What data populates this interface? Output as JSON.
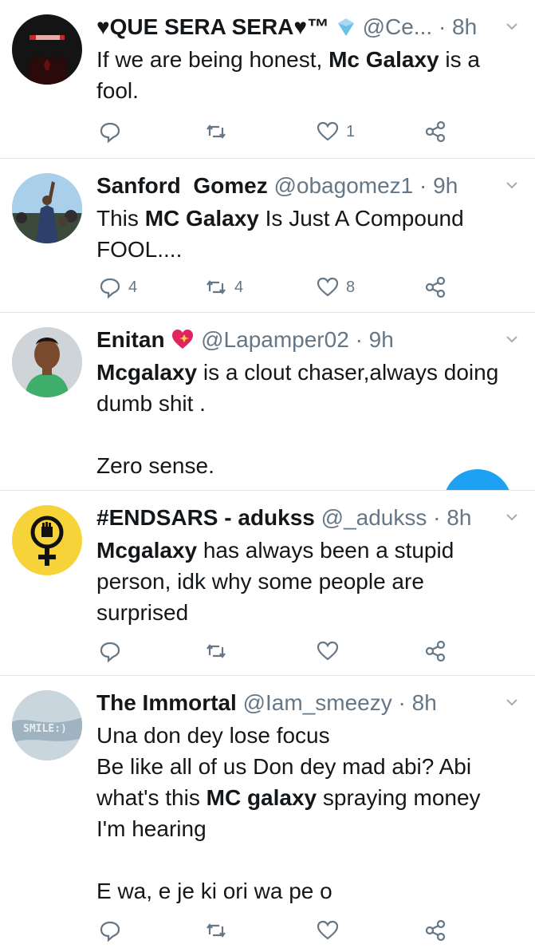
{
  "tweets": [
    {
      "name": "♥QUE SERA SERA♥™",
      "handle": "@Ce...",
      "sep": "·",
      "time": "8h",
      "body": [
        [
          {
            "t": "If we are being honest, "
          },
          {
            "t": "Mc Galaxy",
            "b": true
          },
          {
            "t": " is a fool."
          }
        ]
      ],
      "counts": {
        "reply": "",
        "retweet": "",
        "like": "1"
      }
    },
    {
      "name": "Sanford  Gomez",
      "handle": "@obagomez1",
      "sep": "·",
      "time": "9h",
      "body": [
        [
          {
            "t": "This "
          },
          {
            "t": "MC Galaxy",
            "b": true
          },
          {
            "t": " Is Just A Compound FOOL...."
          }
        ]
      ],
      "counts": {
        "reply": "4",
        "retweet": "4",
        "like": "8"
      }
    },
    {
      "name": "Enitan",
      "handle": "@Lapamper02",
      "sep": "·",
      "time": "9h",
      "body": [
        [
          {
            "t": "Mcgalaxy",
            "b": true
          },
          {
            "t": " is a clout chaser,always doing dumb shit ."
          }
        ],
        [
          {
            "t": "Zero sense."
          }
        ]
      ],
      "counts": {
        "reply": "",
        "retweet": "",
        "like": ""
      }
    },
    {
      "name": "#ENDSARS - adukss",
      "handle": "@_adukss",
      "sep": "·",
      "time": "8h",
      "body": [
        [
          {
            "t": "Mcgalaxy",
            "b": true
          },
          {
            "t": " has always been a stupid person, idk why some people are surprised"
          }
        ]
      ],
      "counts": {
        "reply": "",
        "retweet": "",
        "like": ""
      }
    },
    {
      "name": "The Immortal",
      "handle": "@Iam_smeezy",
      "sep": "·",
      "time": "8h",
      "body": [
        [
          {
            "t": "Una don dey lose focus"
          }
        ],
        [
          {
            "t": "Be like all of us Don dey mad abi? Abi what's this "
          },
          {
            "t": "MC galaxy",
            "b": true
          },
          {
            "t": " spraying money I'm hearing"
          }
        ],
        [
          {
            "t": "E wa, e je ki ori wa pe o"
          }
        ]
      ],
      "counts": {
        "reply": "",
        "retweet": "",
        "like": ""
      }
    }
  ],
  "colors": {
    "muted": "#657786",
    "accent": "#1da1f2",
    "heart_emoji": "#e0245e"
  }
}
